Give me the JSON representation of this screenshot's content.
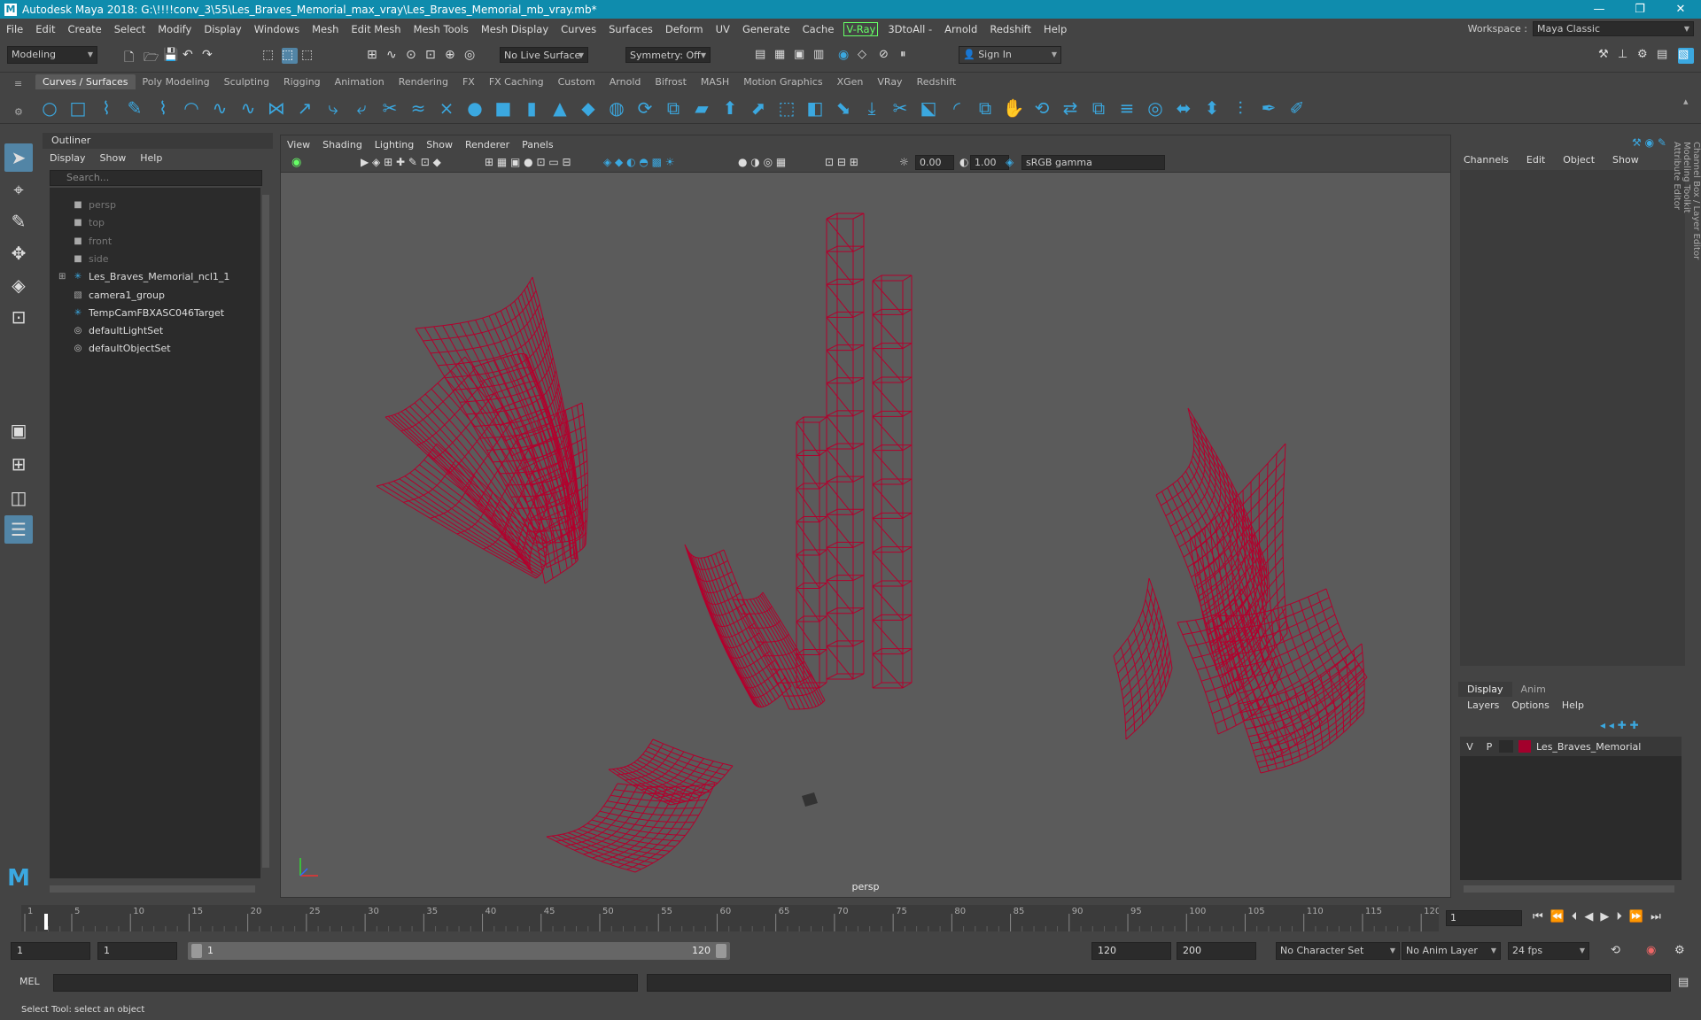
{
  "title": "Autodesk Maya 2018: G:\\!!!!conv_3\\55\\Les_Braves_Memorial_max_vray\\Les_Braves_Memorial_mb_vray.mb*",
  "window_controls": [
    "—",
    "❐",
    "✕"
  ],
  "menubar": {
    "items": [
      "File",
      "Edit",
      "Create",
      "Select",
      "Modify",
      "Display",
      "Windows",
      "Mesh",
      "Edit Mesh",
      "Mesh Tools",
      "Mesh Display",
      "Curves",
      "Surfaces",
      "Deform",
      "UV",
      "Generate",
      "Cache",
      "V-Ray",
      "3DtoAll -",
      "Arnold",
      "Redshift",
      "Help"
    ],
    "workspace_label": "Workspace :",
    "workspace_value": "Maya Classic"
  },
  "statusline": {
    "mode": "Modeling",
    "live_surface": "No Live Surface",
    "symmetry": "Symmetry: Off",
    "sign_in": "Sign In"
  },
  "shelf": {
    "tabs": [
      "Curves / Surfaces",
      "Poly Modeling",
      "Sculpting",
      "Rigging",
      "Animation",
      "Rendering",
      "FX",
      "FX Caching",
      "Custom",
      "Arnold",
      "Bifrost",
      "MASH",
      "Motion Graphics",
      "XGen",
      "VRay",
      "Redshift"
    ],
    "active_tab": "Curves / Surfaces",
    "icons": [
      "circle-curve-icon",
      "square-curve-icon",
      "cv-curve-icon",
      "pencil-curve-icon",
      "ep-curve-icon",
      "arc-icon",
      "curve-tool-icon",
      "bezier-icon",
      "insert-knot-icon",
      "extend-icon",
      "attach-icon",
      "detach-icon",
      "cut-icon",
      "offset-icon",
      "intersect-icon",
      "sphere-icon",
      "cube-icon",
      "cylinder-icon",
      "cone-icon",
      "plane-icon",
      "torus-icon",
      "revolve-icon",
      "loft-icon",
      "planar-icon",
      "extrude-icon",
      "birail-icon",
      "boundary-icon",
      "square-surface-icon",
      "bevel-icon",
      "project-icon",
      "trim-icon",
      "untrim-icon",
      "fillet-icon",
      "stitch-icon",
      "sculpt-icon",
      "rebuild-icon",
      "reverse-icon",
      "duplicate-icon",
      "align-icon",
      "open-close-icon",
      "attach-surface-icon",
      "detach-surface-icon",
      "insert-isoparm-icon",
      "brush-icon",
      "sculpt-brush-icon"
    ]
  },
  "outliner": {
    "title": "Outliner",
    "menus": [
      "Display",
      "Show",
      "Help"
    ],
    "search_placeholder": "Search...",
    "items": [
      {
        "label": "persp",
        "icon": "camera-icon",
        "dim": true
      },
      {
        "label": "top",
        "icon": "camera-icon",
        "dim": true
      },
      {
        "label": "front",
        "icon": "camera-icon",
        "dim": true
      },
      {
        "label": "side",
        "icon": "camera-icon",
        "dim": true
      },
      {
        "label": "Les_Braves_Memorial_ncl1_1",
        "icon": "transform-icon",
        "dim": false,
        "expandable": true
      },
      {
        "label": "camera1_group",
        "icon": "group-icon",
        "dim": false
      },
      {
        "label": "TempCamFBXASC046Target",
        "icon": "transform-icon",
        "dim": false
      },
      {
        "label": "defaultLightSet",
        "icon": "set-icon",
        "dim": false
      },
      {
        "label": "defaultObjectSet",
        "icon": "set-icon",
        "dim": false
      }
    ]
  },
  "viewport": {
    "menus": [
      "View",
      "Shading",
      "Lighting",
      "Show",
      "Renderer",
      "Panels"
    ],
    "exposure": "0.00",
    "gamma": "1.00",
    "color_space": "sRGB gamma",
    "camera_label": "persp",
    "wire_color": "#b3002d"
  },
  "channelbox": {
    "menus": [
      "Channels",
      "Edit",
      "Object",
      "Show"
    ],
    "side_tabs": [
      "Channel Box / Layer Editor",
      "Modeling Toolkit",
      "Attribute Editor"
    ]
  },
  "layers": {
    "tabs": [
      "Display",
      "Anim"
    ],
    "menus": [
      "Layers",
      "Options",
      "Help"
    ],
    "layer": {
      "v": "V",
      "p": "P",
      "name": "Les_Braves_Memorial",
      "color": "#a3002c"
    }
  },
  "timeline": {
    "ticks": [
      1,
      5,
      10,
      15,
      20,
      25,
      30,
      35,
      40,
      45,
      50,
      55,
      60,
      65,
      70,
      75,
      80,
      85,
      90,
      95,
      100,
      105,
      110,
      115,
      120
    ],
    "current_frame": "1",
    "start": 1,
    "end": 120
  },
  "range": {
    "start_field": "1",
    "start2_field": "1",
    "range_start": "1",
    "range_end": "120",
    "end_field": "120",
    "end2_field": "200",
    "character_set": "No Character Set",
    "anim_layer": "No Anim Layer",
    "fps": "24 fps"
  },
  "cmdline": {
    "label": "MEL"
  },
  "helpline": "Select Tool: select an object"
}
